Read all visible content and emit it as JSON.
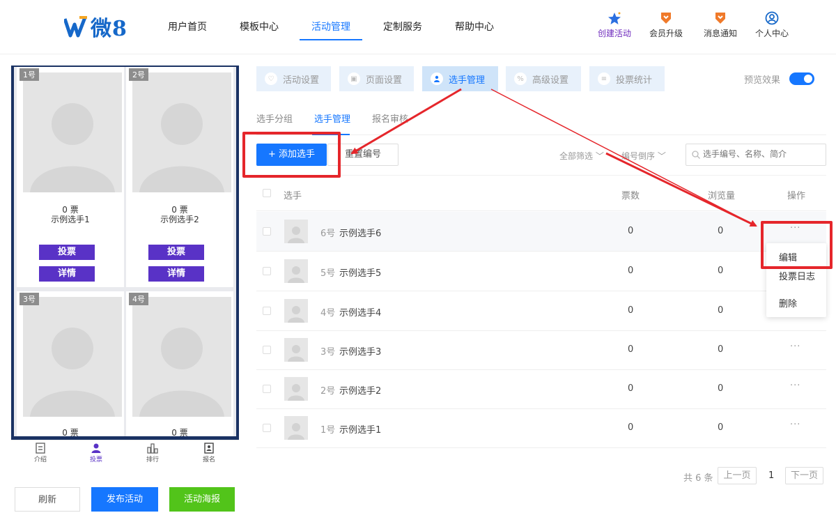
{
  "nav": {
    "logo_text": "微8",
    "items": [
      "用户首页",
      "模板中心",
      "活动管理",
      "定制服务",
      "帮助中心"
    ],
    "active_index": 2,
    "right": [
      {
        "label": "创建活动",
        "icon": "star-rocket-icon"
      },
      {
        "label": "会员升级",
        "icon": "vip-badge-icon"
      },
      {
        "label": "消息通知",
        "icon": "notification-badge-icon"
      },
      {
        "label": "个人中心",
        "icon": "user-circle-icon"
      }
    ]
  },
  "phone": {
    "cards": [
      {
        "num": "1号",
        "votes": "0 票",
        "name": "示例选手1",
        "vote_btn": "投票",
        "detail_btn": "详情"
      },
      {
        "num": "2号",
        "votes": "0 票",
        "name": "示例选手2",
        "vote_btn": "投票",
        "detail_btn": "详情"
      },
      {
        "num": "3号",
        "votes": "0 票"
      },
      {
        "num": "4号",
        "votes": "0 票"
      }
    ],
    "tabbar": [
      "介绍",
      "投票",
      "排行",
      "报名"
    ],
    "tabbar_active": 1
  },
  "actions": {
    "refresh": "刷新",
    "publish": "发布活动",
    "poster": "活动海报"
  },
  "tabs": [
    "活动设置",
    "页面设置",
    "选手管理",
    "高级设置",
    "投票统计"
  ],
  "tabs_active": 2,
  "preview_label": "预览效果",
  "preview_on": true,
  "subtabs": [
    "选手分组",
    "选手管理",
    "报名审核"
  ],
  "subtabs_active": 1,
  "toolbar": {
    "add_label": "+ 添加选手",
    "reset_label": "重置编号",
    "filter_label": "全部筛选 ﹀",
    "sort_label": "编号倒序 ﹀",
    "search_placeholder": "选手编号、名称、简介"
  },
  "table": {
    "headers": {
      "player": "选手",
      "votes": "票数",
      "views": "浏览量",
      "ops": "操作"
    },
    "rows": [
      {
        "no": "6号",
        "name": "示例选手6",
        "votes": "0",
        "views": "0",
        "more": "···"
      },
      {
        "no": "5号",
        "name": "示例选手5",
        "votes": "0",
        "views": "0",
        "more": "···"
      },
      {
        "no": "4号",
        "name": "示例选手4",
        "votes": "0",
        "views": "0",
        "more": "···"
      },
      {
        "no": "3号",
        "name": "示例选手3",
        "votes": "0",
        "views": "0",
        "more": "···"
      },
      {
        "no": "2号",
        "name": "示例选手2",
        "votes": "0",
        "views": "0",
        "more": "···"
      },
      {
        "no": "1号",
        "name": "示例选手1",
        "votes": "0",
        "views": "0",
        "more": "···"
      }
    ]
  },
  "dropdown": [
    "编辑",
    "投票日志",
    "删除"
  ],
  "pager": {
    "total": "共 6 条",
    "prev": "上一页",
    "page": "1",
    "next": "下一页"
  },
  "colors": {
    "primary": "#1677ff",
    "vote_purple": "#5932c6",
    "green": "#52c41a",
    "annotation_red": "#e5262b"
  }
}
